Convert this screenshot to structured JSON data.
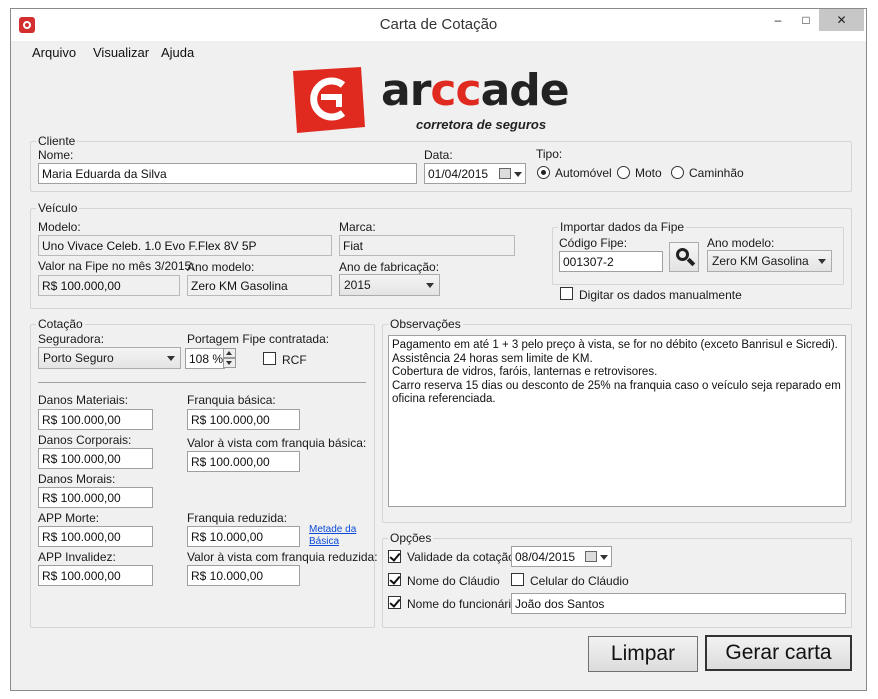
{
  "window": {
    "title": "Carta de Cotação",
    "min": "–",
    "max": "□",
    "close": "✕"
  },
  "menu": [
    "Arquivo",
    "Visualizar",
    "Ajuda"
  ],
  "logo": {
    "word_ar": "ar",
    "word_cc": "cc",
    "word_ade": "ade",
    "tagline": "corretora de seguros",
    "brand_color": "#e02a20"
  },
  "cliente": {
    "legend": "Cliente",
    "nome_label": "Nome:",
    "nome_value": "Maria Eduarda da Silva",
    "data_label": "Data:",
    "data_value": "01/04/2015",
    "tipo_label": "Tipo:",
    "tipo_options": [
      "Automóvel",
      "Moto",
      "Caminhão"
    ],
    "tipo_selected": "Automóvel"
  },
  "veiculo": {
    "legend": "Veículo",
    "modelo_label": "Modelo:",
    "modelo_value": "Uno Vivace Celeb. 1.0 Evo F.Flex 8V 5P",
    "marca_label": "Marca:",
    "marca_value": "Fiat",
    "valor_fipe_label": "Valor na Fipe no mês 3/2015:",
    "valor_fipe_value": "R$ 100.000,00",
    "ano_modelo_label": "Ano modelo:",
    "ano_modelo_value": "Zero KM Gasolina",
    "ano_fab_label": "Ano de fabricação:",
    "ano_fab_value": "2015"
  },
  "fipe": {
    "legend": "Importar dados da Fipe",
    "codigo_label": "Código Fipe:",
    "codigo_value": "001307-2",
    "ano_modelo_label": "Ano modelo:",
    "ano_modelo_value": "Zero KM Gasolina",
    "manual_label": "Digitar os dados manualmente"
  },
  "cotacao": {
    "legend": "Cotação",
    "seguradora_label": "Seguradora:",
    "seguradora_value": "Porto Seguro",
    "portagem_label": "Portagem Fipe contratada:",
    "portagem_value": "108 %",
    "rcf_label": "RCF",
    "danos_materiais_label": "Danos Materiais:",
    "danos_materiais_value": "R$ 100.000,00",
    "danos_corporais_label": "Danos Corporais:",
    "danos_corporais_value": "R$ 100.000,00",
    "danos_morais_label": "Danos Morais:",
    "danos_morais_value": "R$ 100.000,00",
    "app_morte_label": "APP Morte:",
    "app_morte_value": "R$ 100.000,00",
    "app_invalidez_label": "APP Invalidez:",
    "app_invalidez_value": "R$ 100.000,00",
    "franquia_basica_label": "Franquia básica:",
    "franquia_basica_value": "R$ 100.000,00",
    "vista_basica_label": "Valor à vista com franquia básica:",
    "vista_basica_value": "R$ 100.000,00",
    "franquia_reduzida_label": "Franquia reduzida:",
    "franquia_reduzida_value": "R$ 10.000,00",
    "metade_link_1": "Metade da",
    "metade_link_2": "Básica",
    "vista_reduzida_label": "Valor à vista com franquia reduzida:",
    "vista_reduzida_value": "R$ 10.000,00"
  },
  "observacoes": {
    "legend": "Observações",
    "text": "Pagamento em até 1 + 3 pelo preço à vista, se for no débito (exceto Banrisul e Sicredi).\nAssistência 24 horas sem limite de KM.\nCobertura de vidros, faróis, lanternas e retrovisores.\nCarro reserva 15 dias ou desconto de 25% na franquia caso o veículo seja reparado em oficina referenciada."
  },
  "opcoes": {
    "legend": "Opções",
    "validade_label": "Validade da cotação:",
    "validade_value": "08/04/2015",
    "nome_claudio_label": "Nome do Cláudio",
    "celular_claudio_label": "Celular do Cláudio",
    "funcionario_label": "Nome do funcionário:",
    "funcionario_value": "João dos Santos"
  },
  "buttons": {
    "limpar": "Limpar",
    "gerar": "Gerar carta"
  }
}
